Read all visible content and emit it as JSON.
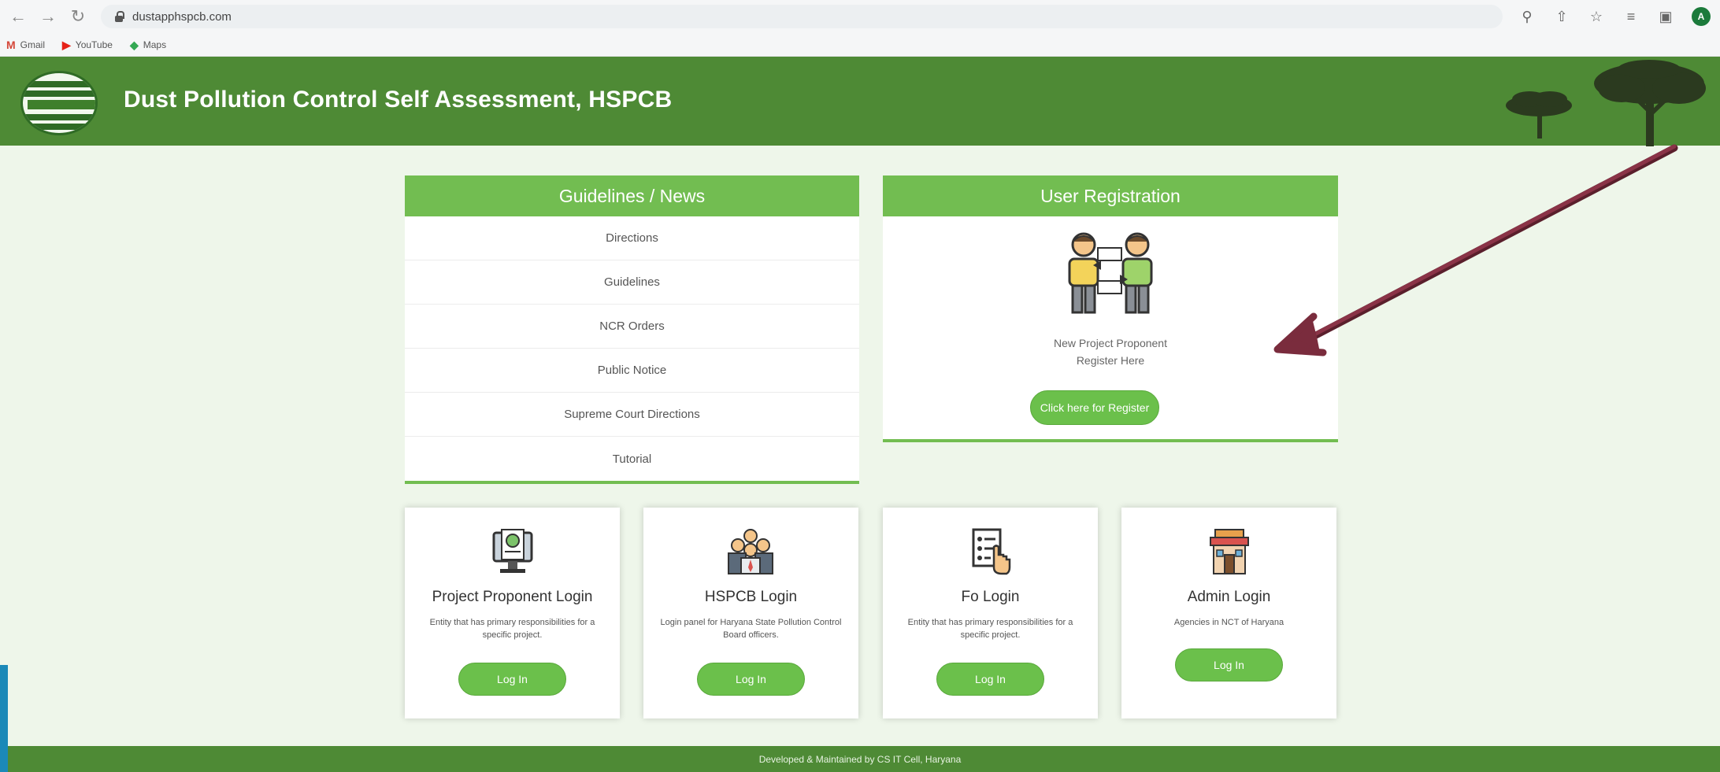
{
  "browser": {
    "url": "dustapphspcb.com",
    "profile_initial": "A",
    "bookmarks": [
      {
        "label": "Gmail"
      },
      {
        "label": "YouTube"
      },
      {
        "label": "Maps"
      }
    ]
  },
  "header": {
    "title": "Dust Pollution Control Self Assessment, HSPCB",
    "brand_color": "#4e8a35"
  },
  "news": {
    "heading": "Guidelines / News",
    "items": [
      "Directions",
      "Guidelines",
      "NCR Orders",
      "Public Notice",
      "Supreme Court Directions",
      "Tutorial"
    ]
  },
  "registration": {
    "heading": "User Registration",
    "line1": "New Project Proponent",
    "line2": "Register Here",
    "button": "Click here for Register"
  },
  "cards": [
    {
      "title": "Project Proponent Login",
      "desc": "Entity that has primary responsibilities for a specific project.",
      "button": "Log In"
    },
    {
      "title": "HSPCB Login",
      "desc": "Login panel for Haryana State Pollution Control Board officers.",
      "button": "Log In"
    },
    {
      "title": "Fo Login",
      "desc": "Entity that has primary responsibilities for a specific project.",
      "button": "Log In"
    },
    {
      "title": "Admin Login",
      "desc": "Agencies in NCT of Haryana",
      "button": "Log In"
    }
  ],
  "footer": {
    "text": "Developed & Maintained by CS IT Cell, Haryana"
  },
  "colors": {
    "accent": "#72bd51",
    "button": "#6bc04b",
    "annotation_arrow": "#7a2c3d"
  }
}
